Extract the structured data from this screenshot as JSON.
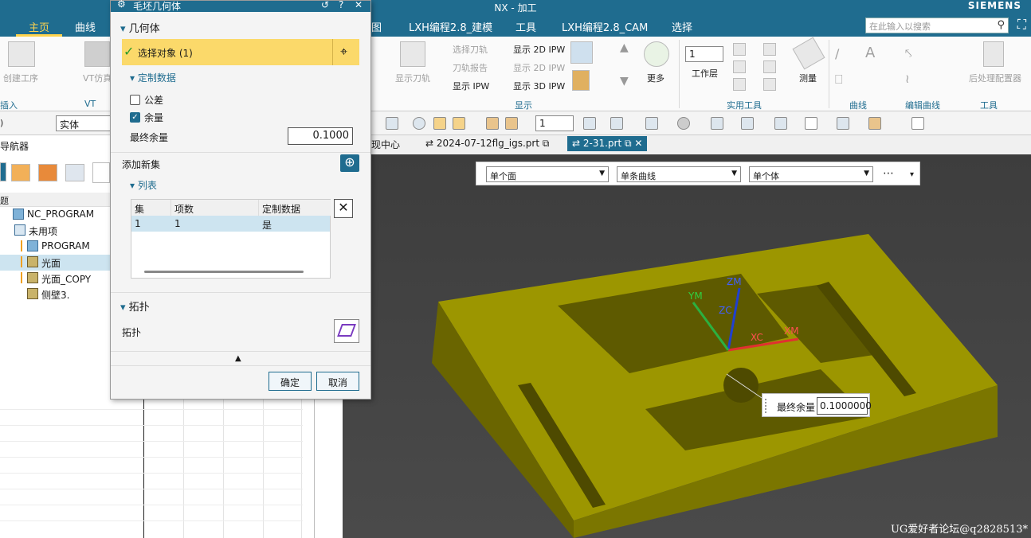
{
  "window": {
    "title": "NX - 加工",
    "brand": "SIEMENS"
  },
  "menu": {
    "tabs": [
      "主页",
      "曲线",
      "图",
      "LXH编程2.8_建模",
      "工具",
      "LXH编程2.8_CAM",
      "选择"
    ],
    "search_placeholder": "在此输入以搜索"
  },
  "ribbon": {
    "left_buttons": [
      "创建工序",
      "VT仿真"
    ],
    "left_groups": [
      "插入",
      "VT"
    ],
    "display_buttons": {
      "show_path": "显示刀轨",
      "select_tool": "选择刀轨",
      "tool_report": "刀轨报告",
      "show_ipw": "显示 IPW",
      "show_2d": "显示 2D IPW",
      "show_2d_dis": "显示 2D IPW",
      "show_3d": "显示 3D IPW",
      "more": "更多"
    },
    "display_group": "显示",
    "layer": {
      "value": "1",
      "label": "工作层"
    },
    "measure": "测量",
    "utility_group": "实用工具",
    "curve_group": "曲线",
    "edit_curve_group": "编辑曲线",
    "postprocess": "后处理配置器",
    "tools_group": "工具"
  },
  "toolbar": {
    "filter_value": "实体",
    "layer_value": "1"
  },
  "navigator": {
    "title": "导航器",
    "column": "题",
    "rows": [
      "NC_PROGRAM",
      "未用项",
      "PROGRAM",
      "光面",
      "光面_COPY",
      "侧壁3."
    ]
  },
  "file_tabs": {
    "tab1": "现中心",
    "tab2": "2024-07-12flg_igs.prt",
    "tab3": "2-31.prt"
  },
  "selection_bar": {
    "face": "单个面",
    "curve": "单条曲线",
    "body": "单个体"
  },
  "axis_labels": {
    "zm": "ZM",
    "ym": "YM",
    "zc": "ZC",
    "xc": "XC",
    "xm": "XM"
  },
  "remainder_popup": {
    "label": "最终余量",
    "value": "0.1000000"
  },
  "watermark": "UG爱好者论坛@q2828513*",
  "dialog": {
    "title": "毛坯几何体",
    "section_geometry": "几何体",
    "select_object": "选择对象 (1)",
    "section_custom": "定制数据",
    "tolerance": "公差",
    "remainder": "余量",
    "final_remainder_label": "最终余量",
    "final_remainder_value": "0.1000",
    "add_set": "添加新集",
    "section_list": "列表",
    "table": {
      "headers": [
        "集",
        "项数",
        "定制数据"
      ],
      "row": [
        "1",
        "1",
        "是"
      ]
    },
    "section_topology": "拓扑",
    "topology_label": "拓扑",
    "ok": "确定",
    "cancel": "取消"
  },
  "colors": {
    "accent": "#1f6c8f",
    "highlight": "#fbd96a",
    "part": "#9c9600"
  }
}
